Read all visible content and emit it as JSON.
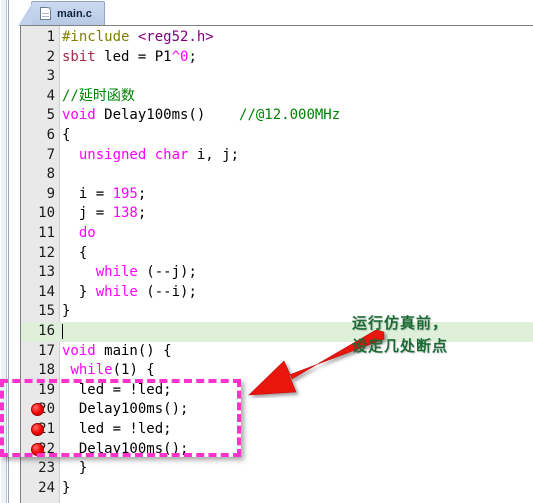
{
  "window": {
    "tab": {
      "label": "main.c",
      "icon": "document-icon"
    }
  },
  "editor": {
    "current_line": 16,
    "breakpoint_lines": [
      20,
      21,
      22
    ],
    "lines": [
      {
        "n": "1",
        "tokens": [
          {
            "t": "#include ",
            "c": "t-pre"
          },
          {
            "t": "<reg52.h>",
            "c": "t-inc"
          }
        ]
      },
      {
        "n": "2",
        "tokens": [
          {
            "t": "sbit",
            "c": "t-kw2"
          },
          {
            "t": " led = P1",
            "c": "t-plain"
          },
          {
            "t": "^",
            "c": "t-num"
          },
          {
            "t": "0",
            "c": "t-num"
          },
          {
            "t": ";",
            "c": "t-plain"
          }
        ]
      },
      {
        "n": "3",
        "tokens": []
      },
      {
        "n": "4",
        "tokens": [
          {
            "t": "//延时函数",
            "c": "t-cmt"
          }
        ]
      },
      {
        "n": "5",
        "tokens": [
          {
            "t": "void",
            "c": "t-kw"
          },
          {
            "t": " Delay100ms()    ",
            "c": "t-plain"
          },
          {
            "t": "//@12.000MHz",
            "c": "t-cmt"
          }
        ]
      },
      {
        "n": "6",
        "tokens": [
          {
            "t": "{",
            "c": "t-plain"
          }
        ]
      },
      {
        "n": "7",
        "tokens": [
          {
            "t": "  ",
            "c": "t-plain"
          },
          {
            "t": "unsigned char",
            "c": "t-kw"
          },
          {
            "t": " i, j;",
            "c": "t-plain"
          }
        ]
      },
      {
        "n": "8",
        "tokens": []
      },
      {
        "n": "9",
        "tokens": [
          {
            "t": "  i = ",
            "c": "t-plain"
          },
          {
            "t": "195",
            "c": "t-num"
          },
          {
            "t": ";",
            "c": "t-plain"
          }
        ]
      },
      {
        "n": "10",
        "tokens": [
          {
            "t": "  j = ",
            "c": "t-plain"
          },
          {
            "t": "138",
            "c": "t-num"
          },
          {
            "t": ";",
            "c": "t-plain"
          }
        ]
      },
      {
        "n": "11",
        "tokens": [
          {
            "t": "  ",
            "c": "t-plain"
          },
          {
            "t": "do",
            "c": "t-kw"
          }
        ]
      },
      {
        "n": "12",
        "tokens": [
          {
            "t": "  {",
            "c": "t-plain"
          }
        ]
      },
      {
        "n": "13",
        "tokens": [
          {
            "t": "    ",
            "c": "t-plain"
          },
          {
            "t": "while",
            "c": "t-kw"
          },
          {
            "t": " (--j);",
            "c": "t-plain"
          }
        ]
      },
      {
        "n": "14",
        "tokens": [
          {
            "t": "  } ",
            "c": "t-plain"
          },
          {
            "t": "while",
            "c": "t-kw"
          },
          {
            "t": " (--i);",
            "c": "t-plain"
          }
        ]
      },
      {
        "n": "15",
        "tokens": [
          {
            "t": "}",
            "c": "t-plain"
          }
        ]
      },
      {
        "n": "16",
        "tokens": []
      },
      {
        "n": "17",
        "tokens": [
          {
            "t": "void",
            "c": "t-kw"
          },
          {
            "t": " main() {",
            "c": "t-plain"
          }
        ]
      },
      {
        "n": "18",
        "tokens": [
          {
            "t": " ",
            "c": "t-plain"
          },
          {
            "t": "while",
            "c": "t-kw"
          },
          {
            "t": "(1) {",
            "c": "t-plain"
          }
        ]
      },
      {
        "n": "19",
        "tokens": [
          {
            "t": "  led = !led;",
            "c": "t-plain"
          }
        ]
      },
      {
        "n": "20",
        "tokens": [
          {
            "t": "  Delay100ms();",
            "c": "t-plain"
          }
        ]
      },
      {
        "n": "21",
        "tokens": [
          {
            "t": "  led = !led;",
            "c": "t-plain"
          }
        ]
      },
      {
        "n": "22",
        "tokens": [
          {
            "t": "  Delay100ms();",
            "c": "t-plain"
          }
        ]
      },
      {
        "n": "23",
        "tokens": [
          {
            "t": "  }",
            "c": "t-plain"
          }
        ]
      },
      {
        "n": "24",
        "tokens": [
          {
            "t": "}",
            "c": "t-plain"
          }
        ]
      }
    ]
  },
  "annotations": {
    "note_line1": "运行仿真前，",
    "note_line2": "设定几处断点",
    "note_color": "#1a6b35",
    "arrow_color": "#e8120f",
    "box_color": "#ff33cc"
  }
}
